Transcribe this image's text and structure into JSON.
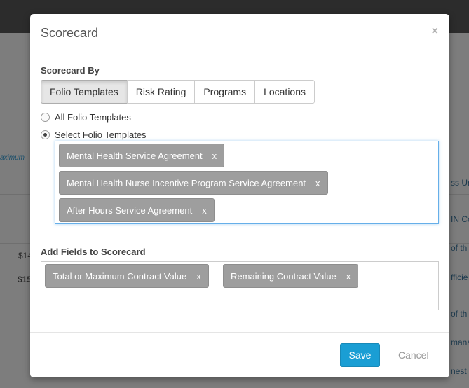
{
  "background": {
    "left_texts": [
      {
        "name": "bg-maximum-header",
        "text": "aximum"
      },
      {
        "name": "bg-value-1",
        "text": "$14"
      },
      {
        "name": "bg-value-2",
        "text": "$15"
      }
    ],
    "right_texts": [
      {
        "name": "bg-right-text-1",
        "text": "ss Ur"
      },
      {
        "name": "bg-right-text-2",
        "text": "IN Co"
      },
      {
        "name": "bg-right-text-3",
        "text": "of th"
      },
      {
        "name": "bg-right-text-4",
        "text": "fficie"
      },
      {
        "name": "bg-right-text-5",
        "text": "of th"
      },
      {
        "name": "bg-right-text-6",
        "text": "mana"
      },
      {
        "name": "bg-right-text-7",
        "text": "nest"
      }
    ]
  },
  "modal": {
    "title": "Scorecard",
    "close_glyph": "×",
    "scorecard_by_label": "Scorecard By",
    "tabs": [
      {
        "label": "Folio Templates",
        "active": true
      },
      {
        "label": "Risk Rating",
        "active": false
      },
      {
        "label": "Programs",
        "active": false
      },
      {
        "label": "Locations",
        "active": false
      }
    ],
    "radios": [
      {
        "label": "All Folio Templates",
        "checked": false
      },
      {
        "label": "Select Folio Templates",
        "checked": true
      }
    ],
    "selected_templates": [
      {
        "label": "Mental Health Service Agreement",
        "remove": "x"
      },
      {
        "label": "Mental Health Nurse Incentive Program Service Agreement",
        "remove": "x"
      },
      {
        "label": "After Hours Service Agreement",
        "remove": "x"
      }
    ],
    "add_fields_label": "Add Fields to Scorecard",
    "selected_fields": [
      {
        "label": "Total or Maximum Contract Value",
        "remove": "x"
      },
      {
        "label": "Remaining Contract Value",
        "remove": "x"
      }
    ],
    "save_label": "Save",
    "cancel_label": "Cancel"
  },
  "colors": {
    "primary_button": "#1a9ed4",
    "tag_background": "#9e9e9e",
    "focus_border": "#66afe9"
  }
}
